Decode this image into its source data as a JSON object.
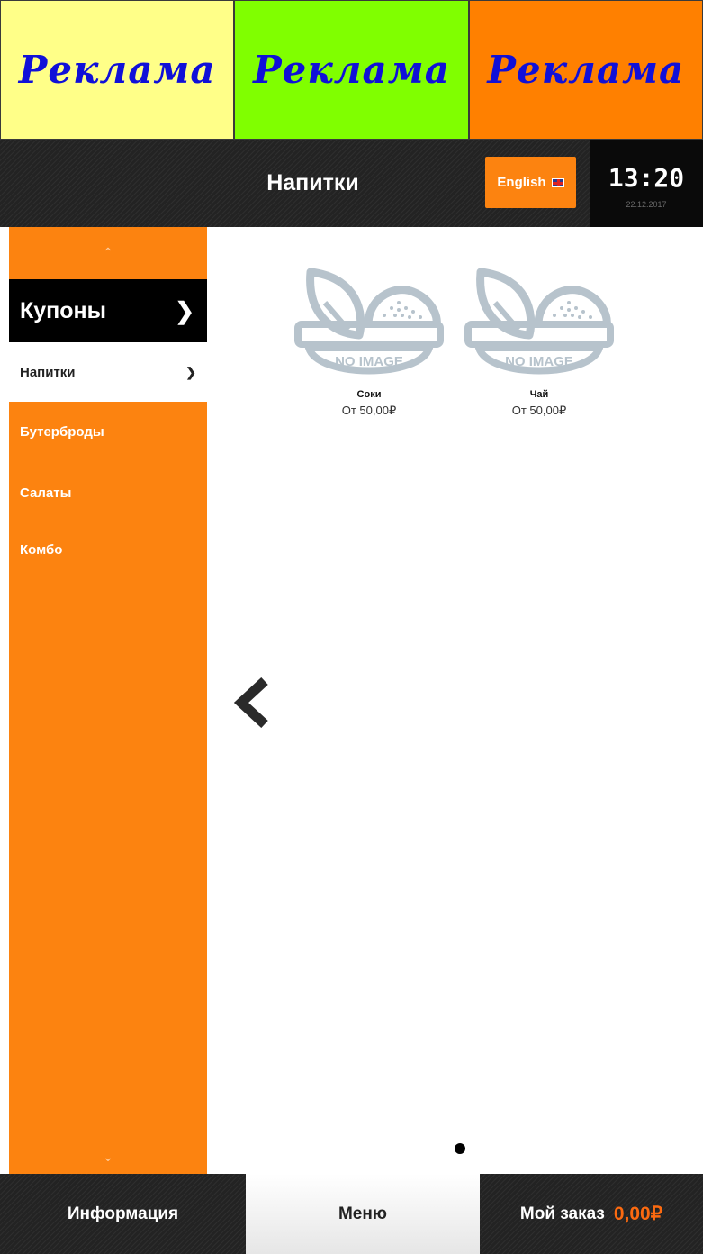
{
  "ads": [
    "Реклама",
    "Реклама",
    "Реклама"
  ],
  "ad_colors": [
    "#ffff88",
    "#80ff00",
    "#ff8000"
  ],
  "accent_color": "#fc8310",
  "header": {
    "title": "Напитки",
    "language_button": "English",
    "language_icon": "uk-flag-icon",
    "time": "13:20",
    "date": "22.12.2017"
  },
  "sidebar": {
    "scroll_up_icon": "chevron-up-icon",
    "scroll_down_icon": "chevron-down-icon",
    "coupons_label": "Купоны",
    "items": [
      {
        "label": "Напитки",
        "active": true
      },
      {
        "label": "Бутерброды"
      },
      {
        "label": "Салаты"
      },
      {
        "label": "Комбо"
      }
    ]
  },
  "products": [
    {
      "name": "Соки",
      "price": "От 50,00₽",
      "image_text": "NO IMAGE"
    },
    {
      "name": "Чай",
      "price": "От 50,00₽",
      "image_text": "NO IMAGE"
    }
  ],
  "pagination": {
    "pages": 1,
    "current": 1
  },
  "footer": {
    "info_label": "Информация",
    "menu_label": "Меню",
    "order_label": "Мой заказ",
    "order_total": "0,00₽"
  }
}
